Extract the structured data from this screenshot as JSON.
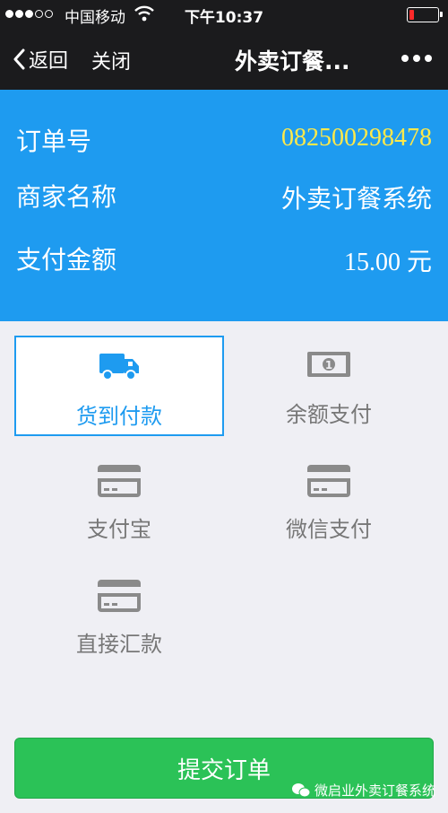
{
  "status_bar": {
    "carrier": "中国移动",
    "time": "下午10:37",
    "signal_bars_filled": 3,
    "signal_bars_total": 5,
    "battery_level": 0.15,
    "battery_color": "#ff2a2a"
  },
  "nav": {
    "back_label": "返回",
    "close_label": "关闭",
    "title": "外卖订餐..."
  },
  "order": {
    "order_no_label": "订单号",
    "order_no_value": "082500298478",
    "merchant_label": "商家名称",
    "merchant_value": "外卖订餐系统",
    "amount_label": "支付金额",
    "amount_value": "15.00 元"
  },
  "payment_methods": [
    {
      "label": "货到付款",
      "icon": "truck-icon",
      "selected": true
    },
    {
      "label": "余额支付",
      "icon": "banknote-icon",
      "selected": false
    },
    {
      "label": "支付宝",
      "icon": "card-icon",
      "selected": false
    },
    {
      "label": "微信支付",
      "icon": "card-icon",
      "selected": false
    },
    {
      "label": "直接汇款",
      "icon": "card-icon",
      "selected": false
    }
  ],
  "submit_label": "提交订单",
  "watermark": "微启业外卖订餐系统",
  "colors": {
    "accent_blue": "#1e9bf0",
    "order_number_yellow": "#ffe94a",
    "submit_green": "#2bc257"
  }
}
